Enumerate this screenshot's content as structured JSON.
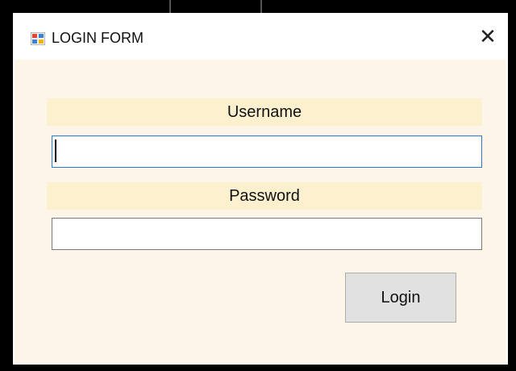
{
  "window": {
    "title": "LOGIN FORM",
    "close_glyph": "✕",
    "icon": "app-form-icon"
  },
  "form": {
    "username_label": "Username",
    "username_value": "",
    "password_label": "Password",
    "password_value": "",
    "login_button_label": "Login"
  },
  "colors": {
    "form_background": "#fdf6e8",
    "label_band": "#fdf0cf",
    "focus_border": "#2b78d4",
    "button_background": "#e1e1e1"
  }
}
